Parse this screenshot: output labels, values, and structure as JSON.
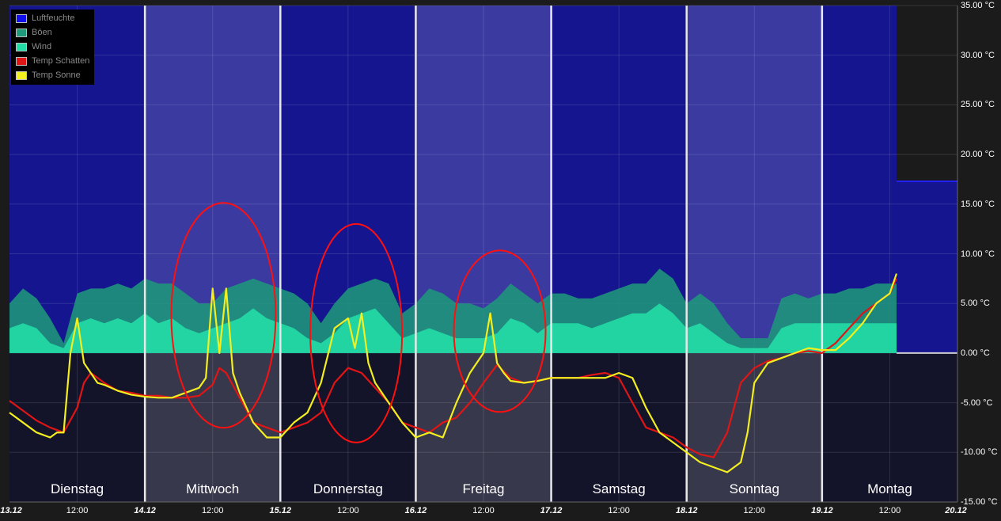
{
  "chart_data": {
    "type": "area",
    "title": "",
    "xlabel": "",
    "ylabel": "",
    "ylim": [
      -15,
      35
    ],
    "y_unit": "°C",
    "y_ticks": [
      "35.00 °C",
      "30.00 °C",
      "25.00 °C",
      "20.00 °C",
      "15.00 °C",
      "10.00 °C",
      "5.00 °C",
      "0.00 °C",
      "-5.00 °C",
      "-10.00 °C",
      "-15.00 °C"
    ],
    "y_tick_values": [
      35,
      30,
      25,
      20,
      15,
      10,
      5,
      0,
      -5,
      -10,
      -15
    ],
    "x_range_days": [
      0,
      7
    ],
    "x_ticks": [
      "13.12",
      "12:00",
      "14.12",
      "12:00",
      "15.12",
      "12:00",
      "16.12",
      "12:00",
      "17.12",
      "12:00",
      "18.12",
      "12:00",
      "19.12",
      "12:00",
      "20.12"
    ],
    "x_tick_days": [
      0,
      0.5,
      1,
      1.5,
      2,
      2.5,
      3,
      3.5,
      4,
      4.5,
      5,
      5.5,
      6,
      6.5,
      7
    ],
    "day_names": [
      "Dienstag",
      "Mittwoch",
      "Donnerstag",
      "Freitag",
      "Samstag",
      "Sonntag",
      "Montag"
    ],
    "grid": true,
    "legend_position": "top-left",
    "series": [
      {
        "name": "Luftfeuchte",
        "color": "#1010ee",
        "kind": "area",
        "x": [
          0,
          6.55,
          6.55,
          7
        ],
        "y": [
          35,
          35,
          17.3,
          17.3
        ]
      },
      {
        "name": "Böen",
        "color": "#1f9a7a",
        "kind": "area",
        "x": [
          0,
          0.1,
          0.2,
          0.3,
          0.4,
          0.5,
          0.6,
          0.7,
          0.8,
          0.9,
          1.0,
          1.1,
          1.2,
          1.3,
          1.4,
          1.5,
          1.6,
          1.7,
          1.8,
          1.9,
          2.0,
          2.1,
          2.2,
          2.3,
          2.4,
          2.5,
          2.6,
          2.7,
          2.8,
          2.9,
          3.0,
          3.1,
          3.2,
          3.3,
          3.4,
          3.5,
          3.6,
          3.7,
          3.8,
          3.9,
          4.0,
          4.1,
          4.2,
          4.3,
          4.4,
          4.5,
          4.6,
          4.7,
          4.8,
          4.9,
          5.0,
          5.1,
          5.2,
          5.3,
          5.4,
          5.5,
          5.6,
          5.7,
          5.8,
          5.9,
          6.0,
          6.1,
          6.2,
          6.3,
          6.4,
          6.5,
          6.55
        ],
        "y": [
          5,
          6.5,
          5.5,
          3.5,
          1,
          6,
          6.5,
          6.5,
          7,
          6.5,
          7.5,
          7,
          7,
          6,
          5,
          5,
          6.5,
          7,
          7.5,
          7,
          6.5,
          6,
          5,
          3,
          5,
          6.5,
          7,
          7.5,
          7,
          4,
          5,
          6.5,
          6,
          5,
          5,
          4.5,
          5.5,
          7,
          6,
          5,
          6,
          6,
          5.5,
          5.5,
          6,
          6.5,
          7,
          7,
          8.5,
          7.5,
          5,
          6,
          5,
          3,
          1.5,
          1.5,
          1.5,
          5.5,
          6,
          5.5,
          6,
          6,
          6.5,
          6.5,
          7,
          7,
          7
        ]
      },
      {
        "name": "Wind",
        "color": "#22dda6",
        "kind": "area",
        "x": [
          0,
          0.1,
          0.2,
          0.3,
          0.4,
          0.5,
          0.6,
          0.7,
          0.8,
          0.9,
          1.0,
          1.1,
          1.2,
          1.3,
          1.4,
          1.5,
          1.6,
          1.7,
          1.8,
          1.9,
          2.0,
          2.1,
          2.2,
          2.3,
          2.4,
          2.5,
          2.6,
          2.7,
          2.8,
          2.9,
          3.0,
          3.1,
          3.2,
          3.3,
          3.4,
          3.5,
          3.6,
          3.7,
          3.8,
          3.9,
          4.0,
          4.1,
          4.2,
          4.3,
          4.4,
          4.5,
          4.6,
          4.7,
          4.8,
          4.9,
          5.0,
          5.1,
          5.2,
          5.3,
          5.4,
          5.5,
          5.6,
          5.7,
          5.8,
          5.9,
          6.0,
          6.1,
          6.2,
          6.3,
          6.4,
          6.5,
          6.55
        ],
        "y": [
          2.5,
          3,
          2.5,
          1,
          0.5,
          3,
          3.5,
          3,
          3.5,
          3,
          4,
          3,
          3.5,
          2.5,
          2,
          2.5,
          3,
          3.5,
          4.5,
          3.5,
          3,
          2.5,
          1.5,
          1,
          2,
          3.5,
          4,
          4.5,
          3,
          1.5,
          2,
          2.5,
          2,
          1.5,
          1.5,
          1.5,
          2,
          3.5,
          3,
          2,
          3,
          3,
          3,
          2.5,
          3,
          3.5,
          4,
          4,
          5,
          4,
          2.5,
          3,
          2,
          1,
          0.5,
          0.5,
          0.5,
          2.5,
          3,
          3,
          3,
          3,
          3,
          3,
          3,
          3,
          3
        ]
      },
      {
        "name": "Temp Schatten",
        "color": "#e01515",
        "kind": "line",
        "x": [
          0,
          0.1,
          0.2,
          0.3,
          0.4,
          0.5,
          0.55,
          0.6,
          0.7,
          0.8,
          0.9,
          1.0,
          1.1,
          1.2,
          1.3,
          1.4,
          1.5,
          1.55,
          1.6,
          1.7,
          1.8,
          1.9,
          2.0,
          2.1,
          2.2,
          2.3,
          2.4,
          2.5,
          2.6,
          2.7,
          2.8,
          2.9,
          3.0,
          3.1,
          3.2,
          3.3,
          3.4,
          3.5,
          3.6,
          3.7,
          3.8,
          3.9,
          4.0,
          4.1,
          4.2,
          4.3,
          4.4,
          4.5,
          4.6,
          4.7,
          4.8,
          4.9,
          5.0,
          5.1,
          5.2,
          5.3,
          5.4,
          5.5,
          5.6,
          5.7,
          5.8,
          5.9,
          6.0,
          6.1,
          6.2,
          6.3,
          6.4,
          6.5,
          6.55
        ],
        "y": [
          -4.8,
          -5.8,
          -6.8,
          -7.5,
          -8,
          -5.5,
          -3,
          -2,
          -3,
          -3.8,
          -4,
          -4.3,
          -4.3,
          -4.5,
          -4.5,
          -4.3,
          -3.2,
          -1.5,
          -2,
          -4.5,
          -7,
          -7.5,
          -8,
          -7.5,
          -7,
          -6,
          -3,
          -1.5,
          -2,
          -3.5,
          -5,
          -7,
          -7.5,
          -8,
          -7,
          -6.5,
          -5,
          -3,
          -1.2,
          -2.5,
          -3,
          -2.8,
          -2.5,
          -2.5,
          -2.5,
          -2.2,
          -2,
          -2.5,
          -5,
          -7.5,
          -8,
          -8.5,
          -9.5,
          -10.2,
          -10.5,
          -8,
          -3,
          -1.5,
          -0.8,
          -0.5,
          0,
          0.2,
          0,
          1,
          2.5,
          4,
          5,
          6,
          7.5
        ]
      },
      {
        "name": "Temp Sonne",
        "color": "#f2ee1f",
        "kind": "line",
        "x": [
          0,
          0.1,
          0.2,
          0.3,
          0.35,
          0.4,
          0.45,
          0.5,
          0.55,
          0.6,
          0.65,
          0.7,
          0.8,
          0.9,
          1.0,
          1.1,
          1.2,
          1.3,
          1.4,
          1.45,
          1.5,
          1.55,
          1.6,
          1.65,
          1.7,
          1.8,
          1.9,
          2.0,
          2.1,
          2.2,
          2.3,
          2.4,
          2.5,
          2.55,
          2.6,
          2.65,
          2.7,
          2.8,
          2.9,
          3.0,
          3.1,
          3.2,
          3.3,
          3.4,
          3.5,
          3.55,
          3.6,
          3.65,
          3.7,
          3.8,
          3.9,
          4.0,
          4.1,
          4.2,
          4.3,
          4.4,
          4.5,
          4.6,
          4.7,
          4.8,
          4.9,
          5.0,
          5.1,
          5.2,
          5.3,
          5.4,
          5.45,
          5.5,
          5.6,
          5.7,
          5.8,
          5.9,
          6.0,
          6.1,
          6.2,
          6.3,
          6.4,
          6.5,
          6.55
        ],
        "y": [
          -6,
          -7,
          -8,
          -8.5,
          -8,
          -8,
          0,
          3.5,
          -1,
          -2,
          -3,
          -3.2,
          -3.8,
          -4.2,
          -4.4,
          -4.5,
          -4.5,
          -4,
          -3.5,
          -2.5,
          6.5,
          0,
          6.5,
          -2,
          -4,
          -7,
          -8.5,
          -8.5,
          -7,
          -6,
          -3,
          2.5,
          3.5,
          0.5,
          4,
          -1,
          -3,
          -5,
          -7,
          -8.5,
          -8,
          -8.5,
          -5,
          -2,
          0,
          4,
          -1,
          -2,
          -2.8,
          -3,
          -2.8,
          -2.5,
          -2.5,
          -2.5,
          -2.5,
          -2.5,
          -2,
          -2.5,
          -5.5,
          -8,
          -9,
          -10,
          -11,
          -11.5,
          -12,
          -11,
          -8,
          -3,
          -1,
          -0.5,
          0,
          0.5,
          0.3,
          0.3,
          1.5,
          3,
          5,
          6,
          8
        ]
      }
    ]
  }
}
